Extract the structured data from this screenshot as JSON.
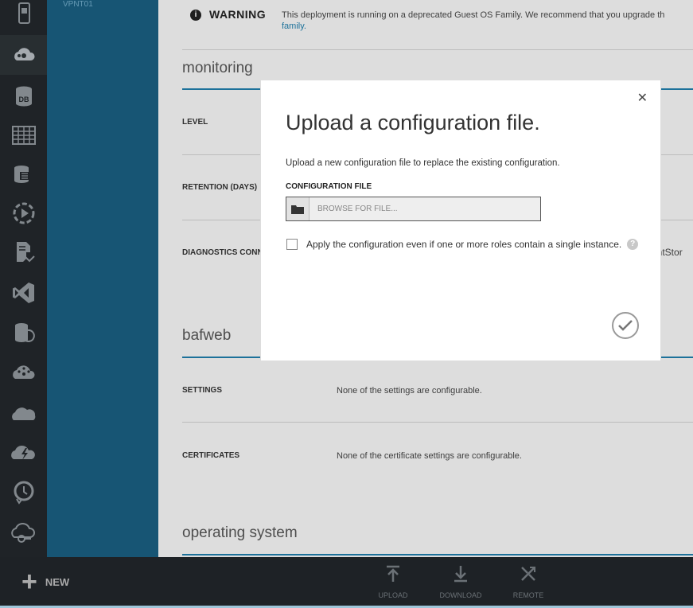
{
  "rail": {
    "items": [
      {
        "icon": "mobile-services-icon"
      },
      {
        "icon": "cloud-services-icon"
      },
      {
        "icon": "sql-database-icon",
        "text": "DB"
      },
      {
        "icon": "storage-table-icon"
      },
      {
        "icon": "hdinsight-icon"
      },
      {
        "icon": "media-services-icon"
      },
      {
        "icon": "service-bus-icon"
      },
      {
        "icon": "visual-studio-icon"
      },
      {
        "icon": "cache-icon"
      },
      {
        "icon": "networks-icon"
      },
      {
        "icon": "traffic-manager-icon"
      },
      {
        "icon": "automation-icon"
      },
      {
        "icon": "scheduler-icon"
      },
      {
        "icon": "remote-app-icon"
      }
    ]
  },
  "subnav": {
    "item": "VPNT01"
  },
  "warning": {
    "label": "WARNING",
    "text": "This deployment is running on a deprecated Guest OS Family. We recommend that you upgrade th",
    "link": "family."
  },
  "monitoring": {
    "title": "monitoring",
    "rows": [
      {
        "label": "LEVEL"
      },
      {
        "label": "RETENTION (DAYS)"
      },
      {
        "label": "DIAGNOSTICS CONN"
      }
    ],
    "clipped": "entStor"
  },
  "role": {
    "title": "bafweb",
    "rows": [
      {
        "label": "SETTINGS",
        "value": "None of the settings are configurable."
      },
      {
        "label": "CERTIFICATES",
        "value": "None of the certificate settings are configurable."
      }
    ]
  },
  "os": {
    "title": "operating system"
  },
  "dialog": {
    "title": "Upload a configuration file.",
    "description": "Upload a new configuration file to replace the existing configuration.",
    "file_label": "CONFIGURATION FILE",
    "file_placeholder": "BROWSE FOR FILE...",
    "checkbox_label": "Apply the configuration even if one or more roles contain a single instance.",
    "checkbox_checked": false
  },
  "bottombar": {
    "new_label": "NEW",
    "commands": [
      {
        "label": "UPLOAD",
        "icon": "upload-icon"
      },
      {
        "label": "DOWNLOAD",
        "icon": "download-icon"
      },
      {
        "label": "REMOTE",
        "icon": "remote-icon"
      }
    ]
  },
  "colors": {
    "accent": "#1f7ba8",
    "rail": "#22272b",
    "subnav": "#1a5d7e",
    "bottombar": "#1e2226"
  }
}
